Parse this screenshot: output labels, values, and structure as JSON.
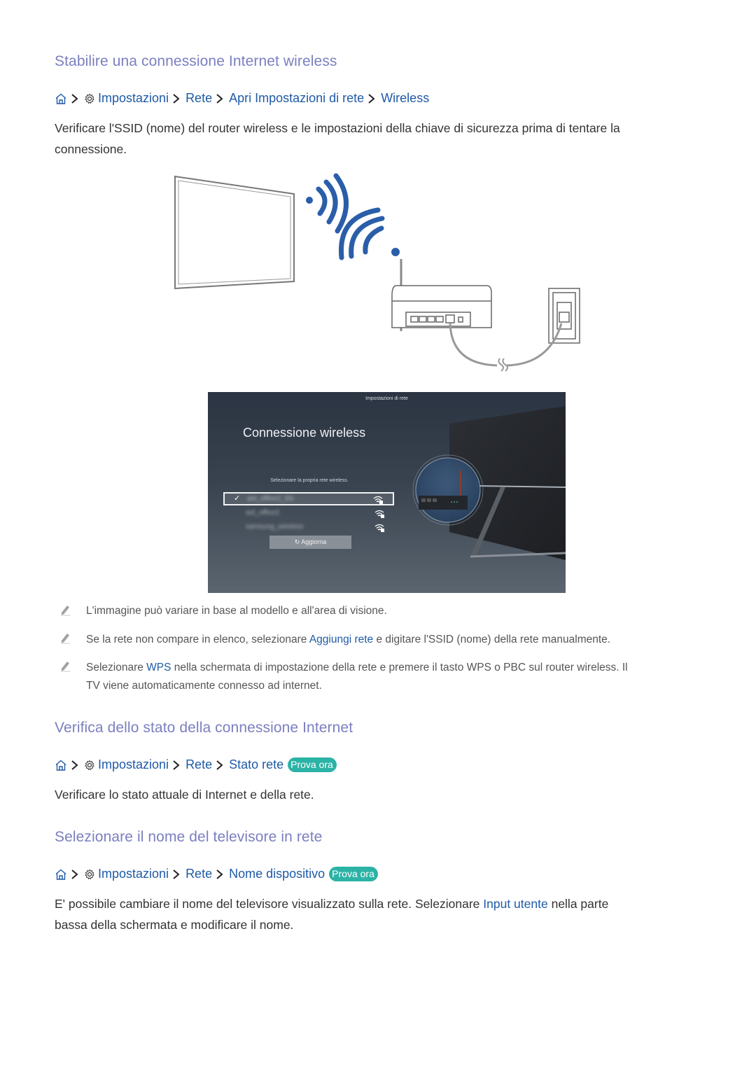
{
  "sections": [
    {
      "heading": "Stabilire una connessione Internet wireless",
      "path": {
        "items": [
          "Impostazioni",
          "Rete",
          "Apri Impostazioni di rete",
          "Wireless"
        ]
      },
      "body": "Verificare l'SSID (nome) del router wireless e le impostazioni della chiave di sicurezza prima di tentare la connessione.",
      "body_line1": "Verificare l'SSID (nome) del router wireless e le impostazioni della chiave di sicurezza prima di tentare la",
      "body_line2": "connessione."
    },
    {
      "heading": "Verifica dello stato della connessione Internet",
      "path": {
        "items": [
          "Impostazioni",
          "Rete",
          "Stato rete"
        ],
        "badge": "Prova ora"
      },
      "body": "Verificare lo stato attuale di Internet e della rete."
    },
    {
      "heading": "Selezionare il nome del televisore in rete",
      "path": {
        "items": [
          "Impostazioni",
          "Rete",
          "Nome dispositivo"
        ],
        "badge": "Prova ora"
      },
      "body_line1_pre": "E' possibile cambiare il nome del televisore visualizzato sulla rete. Selezionare ",
      "body_line1_link": "Input utente",
      "body_line1_post": " nella parte",
      "body_line2": "bassa della schermata e modificare il nome."
    }
  ],
  "illustration": {
    "description": "TV connected wirelessly to router, router wired to wall socket",
    "icons": [
      "tv-icon",
      "wifi-signal-icon",
      "router-icon",
      "wall-socket-icon",
      "cable-icon"
    ]
  },
  "tv_screen": {
    "header": "Impostazioni di rete",
    "title": "Connessione wireless",
    "subtitle": "Selezionare la propria rete wireless.",
    "networks": [
      {
        "ssid": "ast_office2_5G",
        "selected": true
      },
      {
        "ssid": "ast_office2",
        "selected": false
      },
      {
        "ssid": "samsung_wireless",
        "selected": false
      }
    ],
    "refresh_label": "Aggiorna"
  },
  "notes": [
    {
      "text": "L'immagine può variare in base al modello e all'area di visione."
    },
    {
      "pre": "Se la rete non compare in elenco, selezionare ",
      "link": "Aggiungi rete",
      "post": " e digitare l'SSID (nome) della rete manualmente."
    },
    {
      "pre": "Selezionare ",
      "link": "WPS",
      "post_line1": " nella schermata di impostazione della rete e premere il tasto WPS o PBC sul router wireless. Il",
      "line2": "TV viene automaticamente connesso ad internet."
    }
  ],
  "colors": {
    "heading": "#7b7fc0",
    "link": "#1f5aa6",
    "badge": "#2bb3a6",
    "text": "#333333",
    "wifi_blue": "#2a5ea8"
  }
}
